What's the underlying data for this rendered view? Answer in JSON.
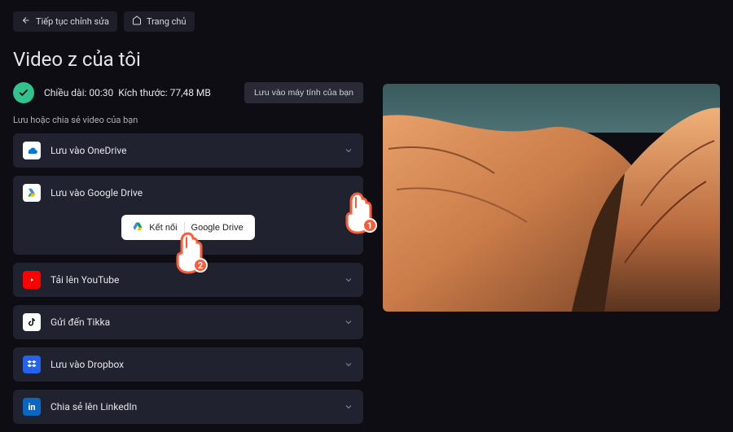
{
  "nav": {
    "back_label": "Tiếp tục chỉnh sửa",
    "home_label": "Trang chủ"
  },
  "page_title": "Video z của tôi",
  "info": {
    "duration_label": "Chiều dài:",
    "duration_value": "00:30",
    "size_label": "Kích thước:",
    "size_value": "77,48 MB",
    "download_label": "Lưu vào máy tính của bạn"
  },
  "section_label": "Lưu hoặc chia sẻ video của bạn",
  "options": {
    "onedrive": {
      "label": "Lưu vào OneDrive"
    },
    "gdrive": {
      "label": "Lưu vào Google Drive",
      "connect_label": "Kết nối",
      "service_label": "Google Drive"
    },
    "youtube": {
      "label": "Tải lên YouTube"
    },
    "tiktok": {
      "label": "Gửi đến Tikka"
    },
    "dropbox": {
      "label": "Lưu vào Dropbox"
    },
    "linkedin": {
      "label": "Chia sẻ lên LinkedIn"
    }
  },
  "colors": {
    "accent": "#32c28e",
    "onedrive": "#0078d4",
    "youtube": "#ff0000",
    "dropbox": "#2563eb",
    "linkedin": "#0a66c2",
    "annotation": "#ff5a36"
  },
  "annotations": {
    "cursor1_badge": "1",
    "cursor2_badge": "2"
  }
}
